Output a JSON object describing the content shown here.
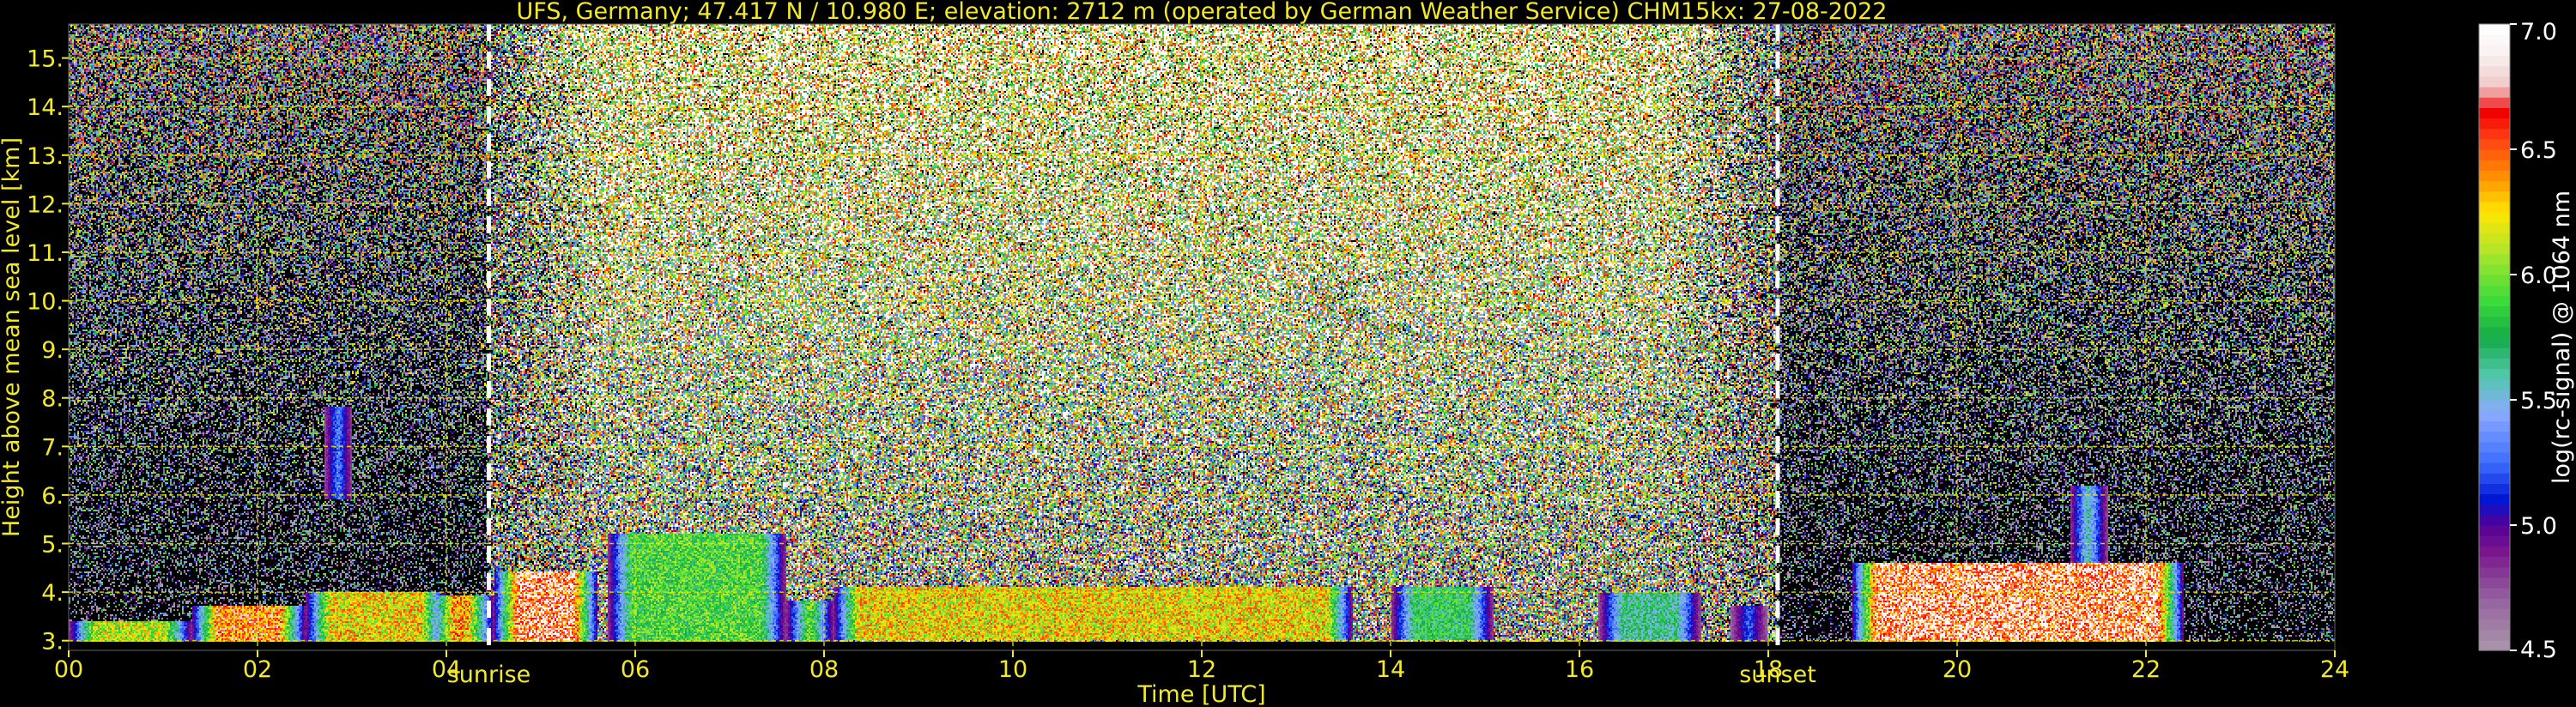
{
  "chart_data": {
    "type": "heatmap",
    "title": "UFS, Germany; 47.417 N / 10.980 E; elevation: 2712 m  (operated by German Weather Service)    CHM15kx: 27-08-2022",
    "xlabel": "Time [UTC]",
    "ylabel": "Height above mean sea level [km]",
    "xlim": [
      0,
      24
    ],
    "ylim": [
      2.8,
      15.7
    ],
    "x_ticks": [
      "00",
      "02",
      "04",
      "06",
      "08",
      "10",
      "12",
      "14",
      "16",
      "18",
      "20",
      "22",
      "24"
    ],
    "y_ticks": [
      "3.",
      "4.",
      "5.",
      "6.",
      "7.",
      "8.",
      "9.",
      "10.",
      "11.",
      "12.",
      "13.",
      "14.",
      "15."
    ],
    "grid": true,
    "colorbar": {
      "label": "log(rc-signal) @ 1064 nm",
      "range": [
        4.5,
        7.0
      ],
      "ticks": [
        "4.5",
        "5.0",
        "5.5",
        "6.0",
        "6.5",
        "7.0"
      ]
    },
    "markers": [
      {
        "label": "sunrise",
        "time": 4.45
      },
      {
        "label": "sunset",
        "time": 18.1
      }
    ],
    "cloud_layers": [
      {
        "start": 0.0,
        "end": 1.3,
        "base": 2.9,
        "top": 3.4,
        "intensity": 0.7
      },
      {
        "start": 1.3,
        "end": 2.5,
        "base": 2.9,
        "top": 3.7,
        "intensity": 0.85
      },
      {
        "start": 2.5,
        "end": 4.0,
        "base": 2.9,
        "top": 4.0,
        "intensity": 0.75
      },
      {
        "start": 2.7,
        "end": 3.0,
        "base": 5.9,
        "top": 7.8,
        "intensity": 0.55
      },
      {
        "start": 3.8,
        "end": 4.5,
        "base": 2.9,
        "top": 3.9,
        "intensity": 0.8
      },
      {
        "start": 4.5,
        "end": 5.6,
        "base": 2.9,
        "top": 4.4,
        "intensity": 0.95
      },
      {
        "start": 5.7,
        "end": 7.6,
        "base": 2.9,
        "top": 5.2,
        "intensity": 0.6
      },
      {
        "start": 7.6,
        "end": 8.1,
        "base": 2.9,
        "top": 3.8,
        "intensity": 0.7
      },
      {
        "start": 8.1,
        "end": 13.6,
        "base": 3.0,
        "top": 4.1,
        "intensity": 0.75
      },
      {
        "start": 14.0,
        "end": 15.1,
        "base": 3.0,
        "top": 4.1,
        "intensity": 0.55
      },
      {
        "start": 16.2,
        "end": 17.3,
        "base": 2.9,
        "top": 4.0,
        "intensity": 0.5
      },
      {
        "start": 17.6,
        "end": 18.0,
        "base": 2.9,
        "top": 3.7,
        "intensity": 0.4
      },
      {
        "start": 18.9,
        "end": 22.4,
        "base": 2.9,
        "top": 4.6,
        "intensity": 0.95
      },
      {
        "start": 21.2,
        "end": 21.6,
        "base": 3.8,
        "top": 6.2,
        "intensity": 0.6
      }
    ]
  }
}
